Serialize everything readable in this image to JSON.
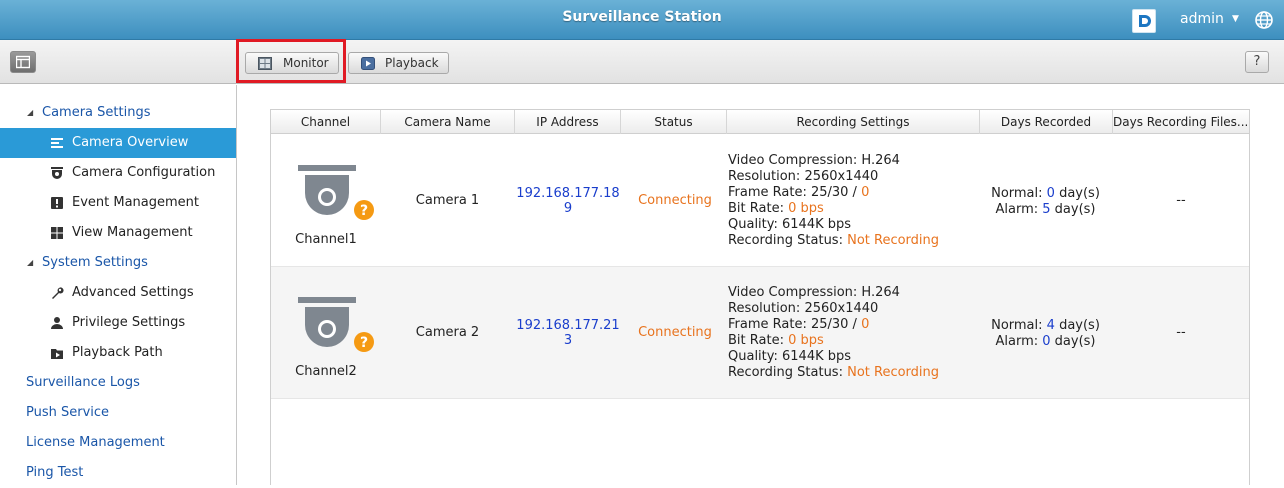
{
  "app": {
    "title": "Surveillance Station",
    "user": "admin"
  },
  "toolbar": {
    "monitor_label": "Monitor",
    "playback_label": "Playback",
    "help_label": "?"
  },
  "sidebar": {
    "camera_settings": "Camera Settings",
    "camera_overview": "Camera Overview",
    "camera_configuration": "Camera Configuration",
    "event_management": "Event Management",
    "view_management": "View Management",
    "system_settings": "System Settings",
    "advanced_settings": "Advanced Settings",
    "privilege_settings": "Privilege Settings",
    "playback_path": "Playback Path",
    "surveillance_logs": "Surveillance Logs",
    "push_service": "Push Service",
    "license_management": "License Management",
    "ping_test": "Ping Test"
  },
  "table": {
    "headers": {
      "channel": "Channel",
      "camera_name": "Camera Name",
      "ip_address": "IP Address",
      "status": "Status",
      "recording_settings": "Recording Settings",
      "days_recorded": "Days Recorded",
      "days_recording_files": "Days Recording Files..."
    },
    "rows": [
      {
        "channel": "Channel1",
        "camera_name": "Camera 1",
        "ip_line1": "192.168.177.18",
        "ip_line2": "9",
        "status": "Connecting",
        "video_compression": "Video Compression: H.264",
        "resolution": "Resolution: 2560x1440",
        "frame_rate_label": "Frame Rate: 25/30 / ",
        "frame_rate_value": "0",
        "bit_rate_label": "Bit Rate: ",
        "bit_rate_value": "0 bps",
        "quality": "Quality: 6144K bps",
        "recording_status_label": "Recording Status: ",
        "recording_status_value": "Not Recording",
        "normal_label": "Normal: ",
        "normal_value": "0",
        "normal_unit": " day(s)",
        "alarm_label": "Alarm: ",
        "alarm_value": "5",
        "alarm_unit": " day(s)",
        "days_recording_files": "--"
      },
      {
        "channel": "Channel2",
        "camera_name": "Camera 2",
        "ip_line1": "192.168.177.21",
        "ip_line2": "3",
        "status": "Connecting",
        "video_compression": "Video Compression: H.264",
        "resolution": "Resolution: 2560x1440",
        "frame_rate_label": "Frame Rate: 25/30 / ",
        "frame_rate_value": "0",
        "bit_rate_label": "Bit Rate: ",
        "bit_rate_value": "0 bps",
        "quality": "Quality: 6144K bps",
        "recording_status_label": "Recording Status: ",
        "recording_status_value": "Not Recording",
        "normal_label": "Normal: ",
        "normal_value": "4",
        "normal_unit": " day(s)",
        "alarm_label": "Alarm: ",
        "alarm_value": "0",
        "alarm_unit": " day(s)",
        "days_recording_files": "--"
      }
    ]
  },
  "colors": {
    "titlebar": "#3d8fbf",
    "active_item": "#2a9ad7",
    "link_blue": "#1a56a8",
    "status_orange": "#e8731e",
    "ip_blue": "#1a3ecc",
    "highlight_red": "#e01a24"
  }
}
